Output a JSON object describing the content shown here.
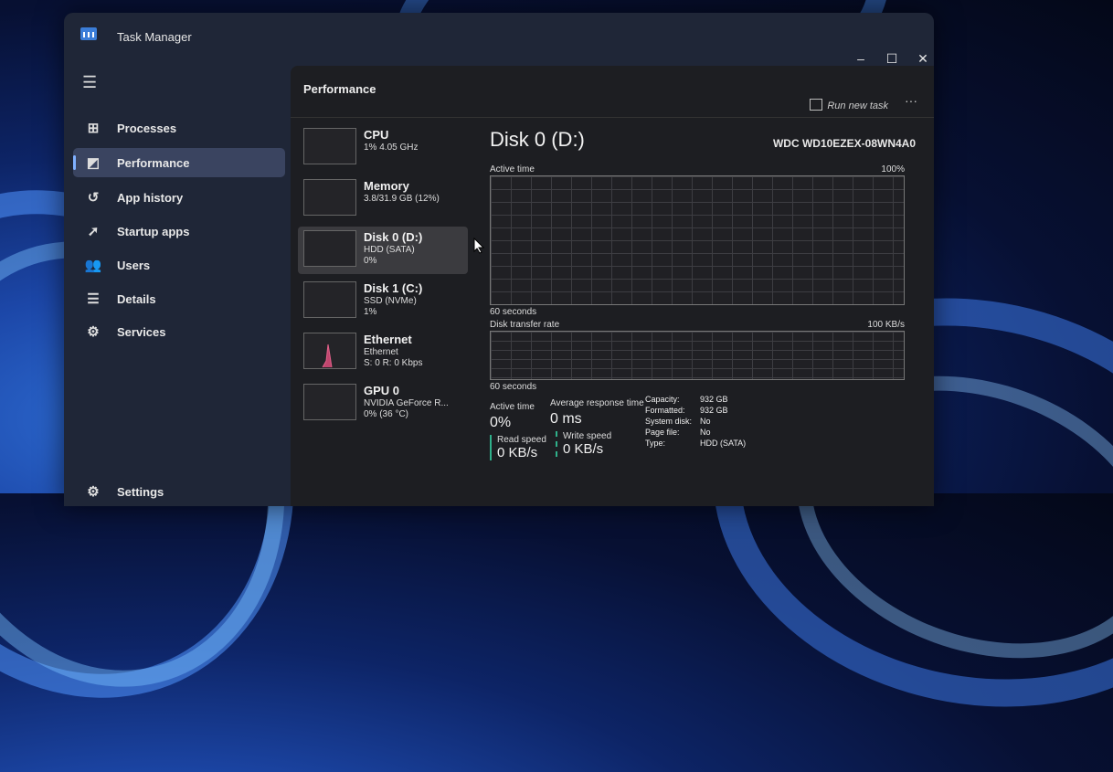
{
  "window": {
    "title": "Task Manager",
    "min": "–",
    "max": "☐",
    "close": "✕"
  },
  "sidebar": {
    "items": [
      {
        "label": "Processes",
        "icon": "processes-icon"
      },
      {
        "label": "Performance",
        "icon": "performance-icon"
      },
      {
        "label": "App history",
        "icon": "history-icon"
      },
      {
        "label": "Startup apps",
        "icon": "startup-icon"
      },
      {
        "label": "Users",
        "icon": "users-icon"
      },
      {
        "label": "Details",
        "icon": "details-icon"
      },
      {
        "label": "Services",
        "icon": "services-icon"
      }
    ],
    "settings": "Settings"
  },
  "header": {
    "title": "Performance",
    "run_task": "Run new task",
    "more": "···"
  },
  "devices": [
    {
      "name": "CPU",
      "l1": "1% 4.05 GHz",
      "l2": ""
    },
    {
      "name": "Memory",
      "l1": "3.8/31.9 GB (12%)",
      "l2": ""
    },
    {
      "name": "Disk 0 (D:)",
      "l1": "HDD (SATA)",
      "l2": "0%"
    },
    {
      "name": "Disk 1 (C:)",
      "l1": "SSD (NVMe)",
      "l2": "1%"
    },
    {
      "name": "Ethernet",
      "l1": "Ethernet",
      "l2": "S: 0 R: 0 Kbps"
    },
    {
      "name": "GPU 0",
      "l1": "NVIDIA GeForce R...",
      "l2": "0% (36 °C)"
    }
  ],
  "detail": {
    "title": "Disk 0 (D:)",
    "model": "WDC WD10EZEX-08WN4A0",
    "graph1": {
      "label": "Active time",
      "max": "100%",
      "time": "60 seconds"
    },
    "graph2": {
      "label": "Disk transfer rate",
      "max": "100 KB/s",
      "time": "60 seconds"
    },
    "active_time": {
      "label": "Active time",
      "value": "0%"
    },
    "avg_response": {
      "label": "Average response time",
      "value": "0 ms"
    },
    "read": {
      "label": "Read speed",
      "value": "0 KB/s"
    },
    "write": {
      "label": "Write speed",
      "value": "0 KB/s"
    },
    "props": [
      {
        "k": "Capacity:",
        "v": "932 GB"
      },
      {
        "k": "Formatted:",
        "v": "932 GB"
      },
      {
        "k": "System disk:",
        "v": "No"
      },
      {
        "k": "Page file:",
        "v": "No"
      },
      {
        "k": "Type:",
        "v": "HDD (SATA)"
      }
    ]
  }
}
